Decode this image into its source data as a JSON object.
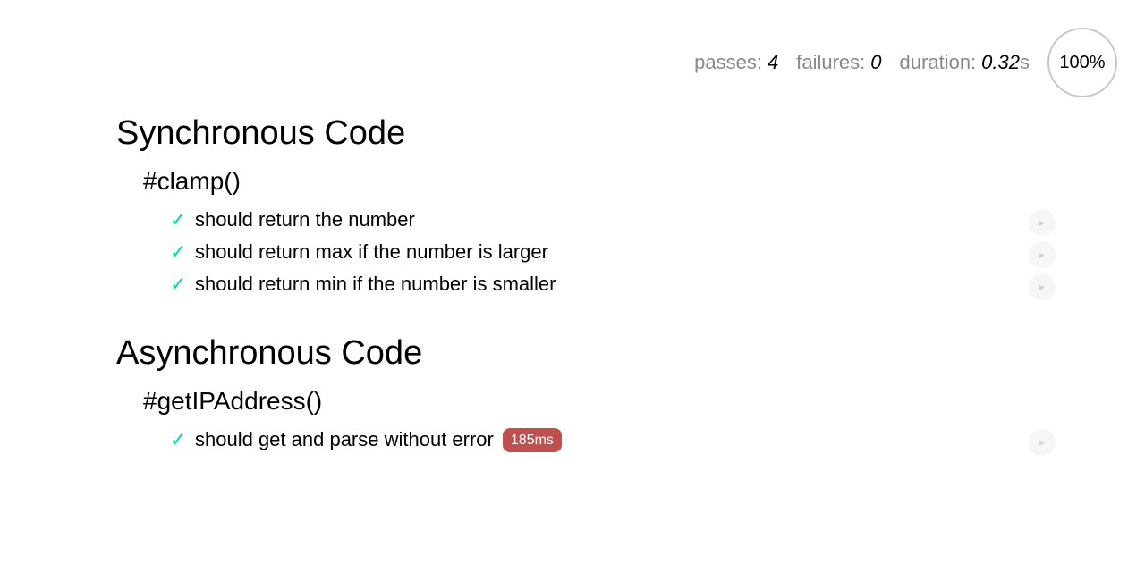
{
  "stats": {
    "passes_label": "passes:",
    "passes_value": "4",
    "failures_label": "failures:",
    "failures_value": "0",
    "duration_label": "duration:",
    "duration_value": "0.32",
    "duration_unit": "s",
    "progress_label": "100%",
    "progress_fraction": 1.0
  },
  "suites": [
    {
      "title": "Synchronous Code",
      "describe": "#clamp()",
      "tests": [
        {
          "title": "should return the number",
          "status": "passed"
        },
        {
          "title": "should return max if the number is larger",
          "status": "passed"
        },
        {
          "title": "should return min if the number is smaller",
          "status": "passed"
        }
      ]
    },
    {
      "title": "Asynchronous Code",
      "describe": "#getIPAddress()",
      "tests": [
        {
          "title": "should get and parse without error",
          "status": "passed",
          "duration": "185ms"
        }
      ]
    }
  ],
  "icons": {
    "check": "✓",
    "replay": "▶"
  },
  "colors": {
    "pass": "#00d6b2",
    "slow_badge": "#c0504d"
  }
}
